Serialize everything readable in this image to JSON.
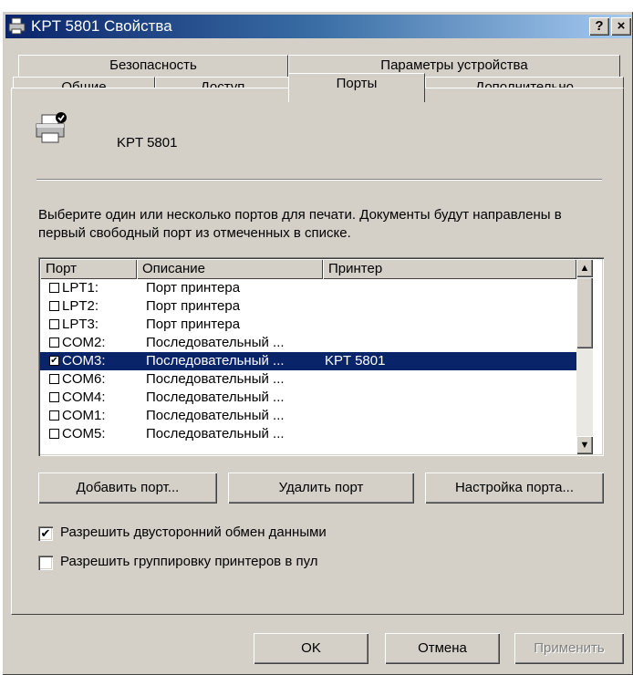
{
  "window": {
    "title": "KPT 5801 Свойства",
    "help_label": "?",
    "close_label": "×"
  },
  "tabs": {
    "row1": [
      "Безопасность",
      "Параметры устройства"
    ],
    "row2": [
      "Общие",
      "Доступ",
      "Порты",
      "Дополнительно"
    ],
    "active": "Порты"
  },
  "printer": {
    "name": "KPT 5801"
  },
  "description": "Выберите один или несколько портов для печати. Документы будут направлены в первый свободный порт из отмеченных в списке.",
  "ports": {
    "columns": [
      "Порт",
      "Описание",
      "Принтер"
    ],
    "rows": [
      {
        "checked": false,
        "port": "LPT1:",
        "desc": "Порт принтера",
        "printer": ""
      },
      {
        "checked": false,
        "port": "LPT2:",
        "desc": "Порт принтера",
        "printer": ""
      },
      {
        "checked": false,
        "port": "LPT3:",
        "desc": "Порт принтера",
        "printer": ""
      },
      {
        "checked": false,
        "port": "COM2:",
        "desc": "Последовательный ...",
        "printer": ""
      },
      {
        "checked": true,
        "port": "COM3:",
        "desc": "Последовательный ...",
        "printer": "KPT 5801",
        "selected": true
      },
      {
        "checked": false,
        "port": "COM6:",
        "desc": "Последовательный ...",
        "printer": ""
      },
      {
        "checked": false,
        "port": "COM4:",
        "desc": "Последовательный ...",
        "printer": ""
      },
      {
        "checked": false,
        "port": "COM1:",
        "desc": "Последовательный ...",
        "printer": ""
      },
      {
        "checked": false,
        "port": "COM5:",
        "desc": "Последовательный ...",
        "printer": ""
      }
    ]
  },
  "buttons": {
    "add_port": "Добавить порт...",
    "delete_port": "Удалить порт",
    "configure_port": "Настройка порта...",
    "ok": "OK",
    "cancel": "Отмена",
    "apply": "Применить"
  },
  "options": {
    "bidirectional": {
      "label": "Разрешить двусторонний обмен данными",
      "checked": true
    },
    "pooling": {
      "label": "Разрешить группировку принтеров в пул",
      "checked": false
    }
  },
  "icons": {
    "printer": "printer-icon",
    "check": "check-mark-icon",
    "scroll_up": "arrow-up-icon",
    "scroll_down": "arrow-down-icon"
  },
  "colors": {
    "titlebar_start": "#0a246a",
    "titlebar_end": "#a6caf0",
    "face": "#d4d0c8",
    "selection": "#0a246a"
  }
}
